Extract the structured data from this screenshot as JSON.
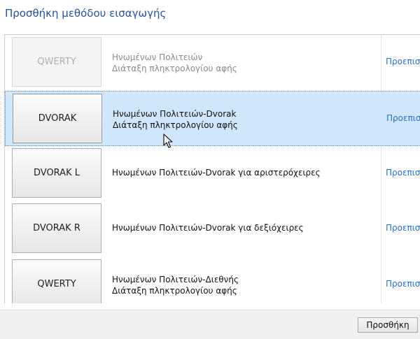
{
  "dialog": {
    "title": "Προσθήκη μεθόδου εισαγωγής"
  },
  "layouts": [
    {
      "key_label": "QWERTY",
      "line1": "Ηνωμένων Πολιτειών",
      "line2": "Διάταξη πληκτρολογίου αφής",
      "preview": "Προεπισκ",
      "state": "disabled"
    },
    {
      "key_label": "DVORAK",
      "line1": "Ηνωμένων Πολιτειών-Dvorak",
      "line2": "Διάταξη πληκτρολογίου αφής",
      "preview": "Προεπισκ",
      "state": "selected"
    },
    {
      "key_label": "DVORAK L",
      "line1": "Ηνωμένων Πολιτειών-Dvorak για αριστερόχειρες",
      "line2": "",
      "preview": "Προεπισκ",
      "state": "normal"
    },
    {
      "key_label": "DVORAK R",
      "line1": "Ηνωμένων Πολιτειών-Dvorak για δεξιόχειρες",
      "line2": "",
      "preview": "Προεπισκ",
      "state": "normal"
    },
    {
      "key_label": "QWERTY",
      "line1": "Ηνωμένων Πολιτειών-Διεθνής",
      "line2": "Διάταξη πληκτρολογίου αφής",
      "preview": "Προεπισκ",
      "state": "normal"
    }
  ],
  "footer": {
    "add_label": "Προσθήκη"
  }
}
